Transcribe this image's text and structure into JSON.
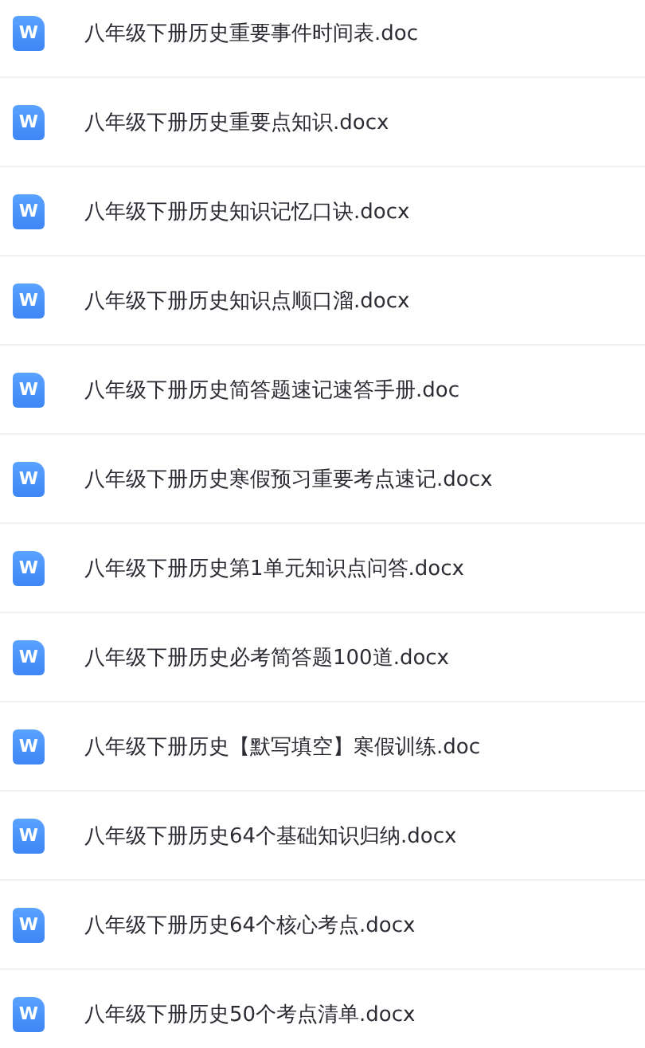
{
  "files": [
    {
      "icon_text": "W",
      "name": "八年级下册历史重要事件时间表.doc"
    },
    {
      "icon_text": "W",
      "name": "八年级下册历史重要点知识.docx"
    },
    {
      "icon_text": "W",
      "name": "八年级下册历史知识记忆口诀.docx"
    },
    {
      "icon_text": "W",
      "name": "八年级下册历史知识点顺口溜.docx"
    },
    {
      "icon_text": "W",
      "name": "八年级下册历史简答题速记速答手册.doc"
    },
    {
      "icon_text": "W",
      "name": "八年级下册历史寒假预习重要考点速记.docx"
    },
    {
      "icon_text": "W",
      "name": "八年级下册历史第1单元知识点问答.docx"
    },
    {
      "icon_text": "W",
      "name": "八年级下册历史必考简答题100道.docx"
    },
    {
      "icon_text": "W",
      "name": "八年级下册历史【默写填空】寒假训练.doc"
    },
    {
      "icon_text": "W",
      "name": "八年级下册历史64个基础知识归纳.docx"
    },
    {
      "icon_text": "W",
      "name": "八年级下册历史64个核心考点.docx"
    },
    {
      "icon_text": "W",
      "name": "八年级下册历史50个考点清单.docx"
    }
  ]
}
